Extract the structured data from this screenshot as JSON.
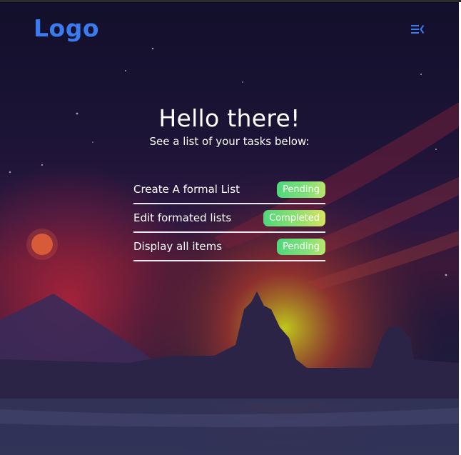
{
  "header": {
    "logo": "Logo",
    "menu_icon": "menu-collapse-icon"
  },
  "hero": {
    "title": "Hello there!",
    "subtitle": "See a list of your tasks below:"
  },
  "tasks": [
    {
      "label": "Create A formal List",
      "status": "Pending"
    },
    {
      "label": "Edit formated lists",
      "status": "Completed"
    },
    {
      "label": "Display all items",
      "status": "Pending"
    }
  ],
  "colors": {
    "logo": "#3a7bf0",
    "badge_start": "#4fd87a",
    "badge_end": "#b8e66a",
    "text": "#ffffff"
  }
}
